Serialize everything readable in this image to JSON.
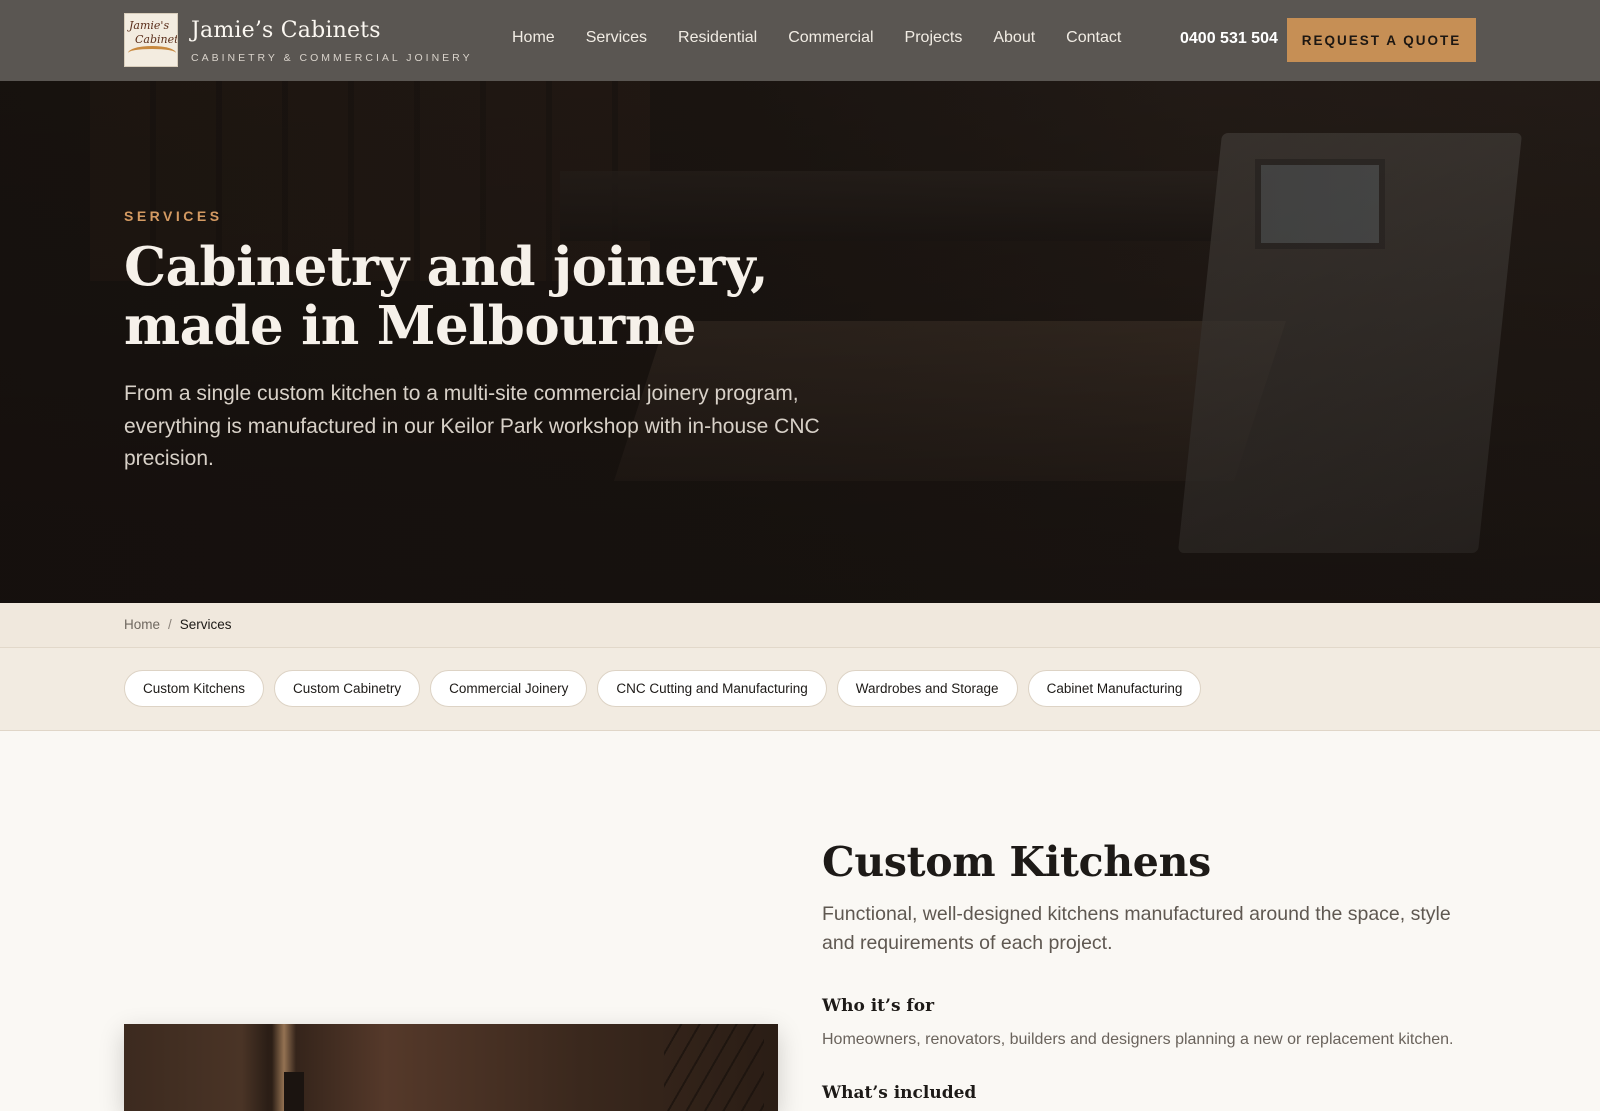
{
  "brand": {
    "logo_text_1": "Jamie's",
    "logo_text_2": "Cabinets",
    "name": "Jamie’s Cabinets",
    "tagline": "CABINETRY & COMMERCIAL JOINERY"
  },
  "nav": {
    "items": [
      "Home",
      "Services",
      "Residential",
      "Commercial",
      "Projects",
      "About",
      "Contact"
    ],
    "phone": "0400 531 504",
    "cta": "REQUEST A QUOTE"
  },
  "hero": {
    "eyebrow": "SERVICES",
    "title": "Cabinetry and joinery, made in Melbourne",
    "subtitle": "From a single custom kitchen to a multi-site commercial joinery program, everything is manufactured in our Keilor Park workshop with in-house CNC precision."
  },
  "breadcrumb": {
    "home": "Home",
    "separator": "/",
    "current": "Services"
  },
  "service_pills": [
    "Custom Kitchens",
    "Custom Cabinetry",
    "Commercial Joinery",
    "CNC Cutting and Manufacturing",
    "Wardrobes and Storage",
    "Cabinet Manufacturing"
  ],
  "section": {
    "title": "Custom Kitchens",
    "lead": "Functional, well-designed kitchens manufactured around the space, style and requirements of each project.",
    "who_heading": "Who it’s for",
    "who_text": "Homeowners, renovators, builders and designers planning a new or replacement kitchen.",
    "included_heading": "What’s included"
  },
  "colors": {
    "header_bg": "#5a5652",
    "accent": "#c68f55",
    "eyebrow": "#d49a62",
    "page_bg": "#faf8f4",
    "band_bg": "#f0e8dd"
  }
}
